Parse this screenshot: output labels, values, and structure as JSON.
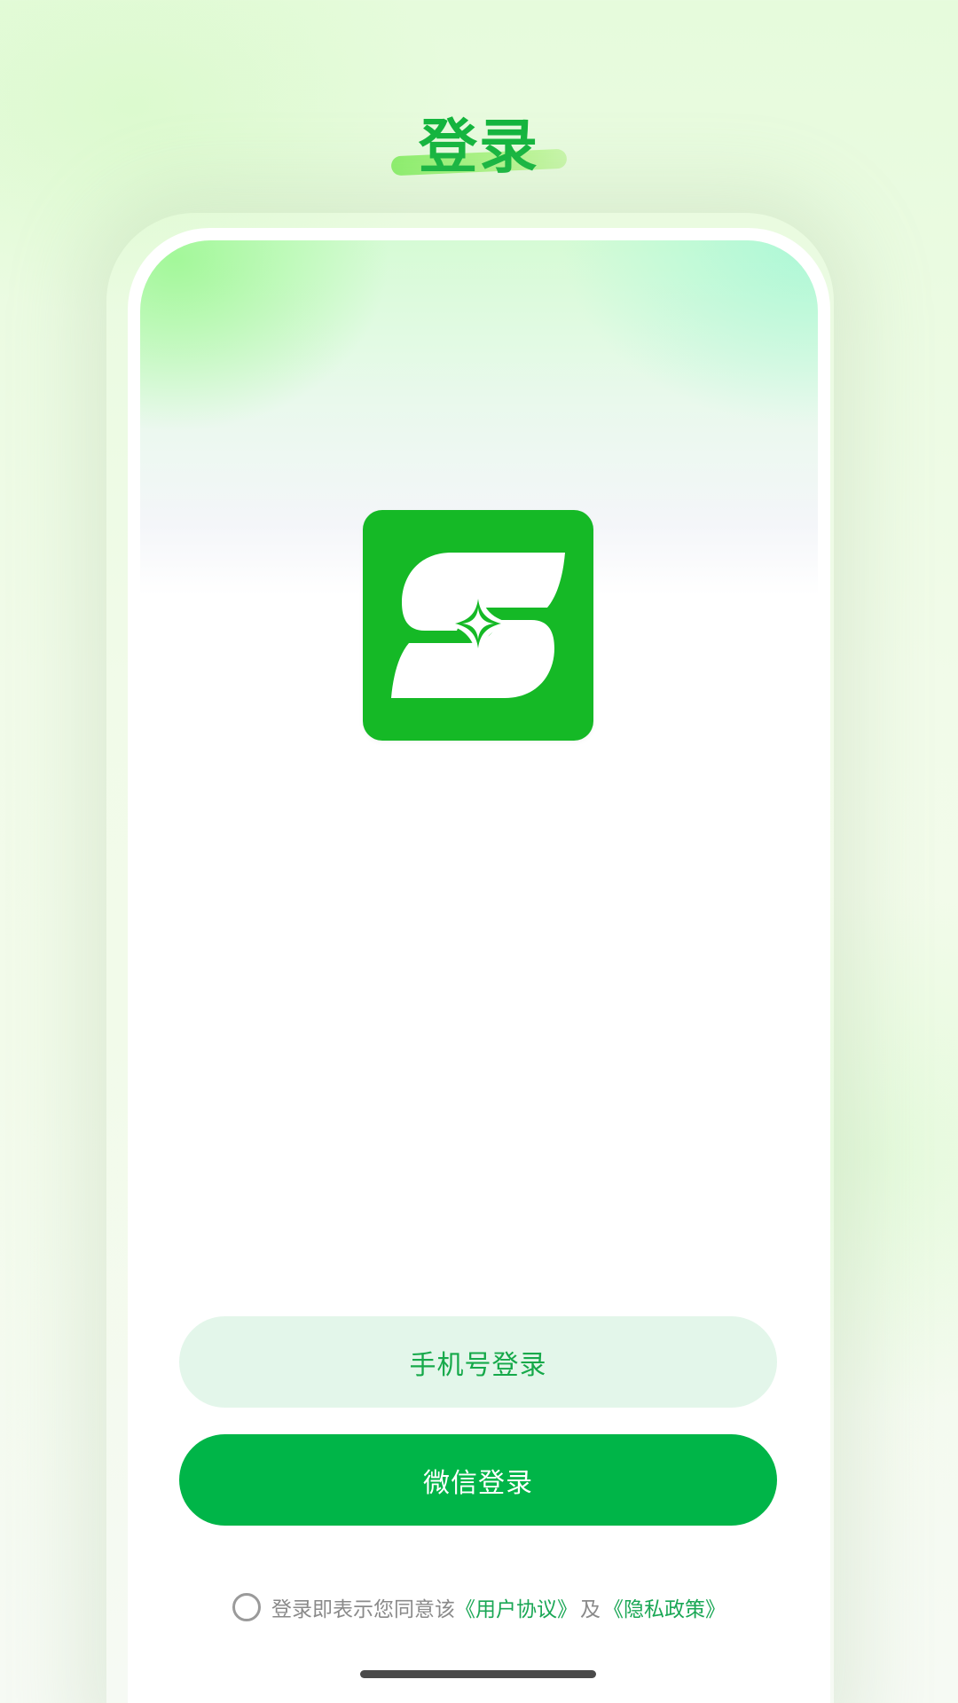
{
  "header": {
    "title": "登录"
  },
  "logo": {
    "icon": "app-s-star-logo",
    "background_color": "#15b926"
  },
  "buttons": {
    "phone_login": "手机号登录",
    "wechat_login": "微信登录"
  },
  "agreement": {
    "checked": false,
    "prefix": "登录即表示您同意该",
    "user_agreement": "《用户协议》",
    "and": "及",
    "privacy_policy": "《隐私政策》"
  },
  "colors": {
    "primary": "#00b548",
    "title": "#14b53e",
    "link": "#1aa755",
    "secondary_button_bg": "#e3f6ea"
  }
}
